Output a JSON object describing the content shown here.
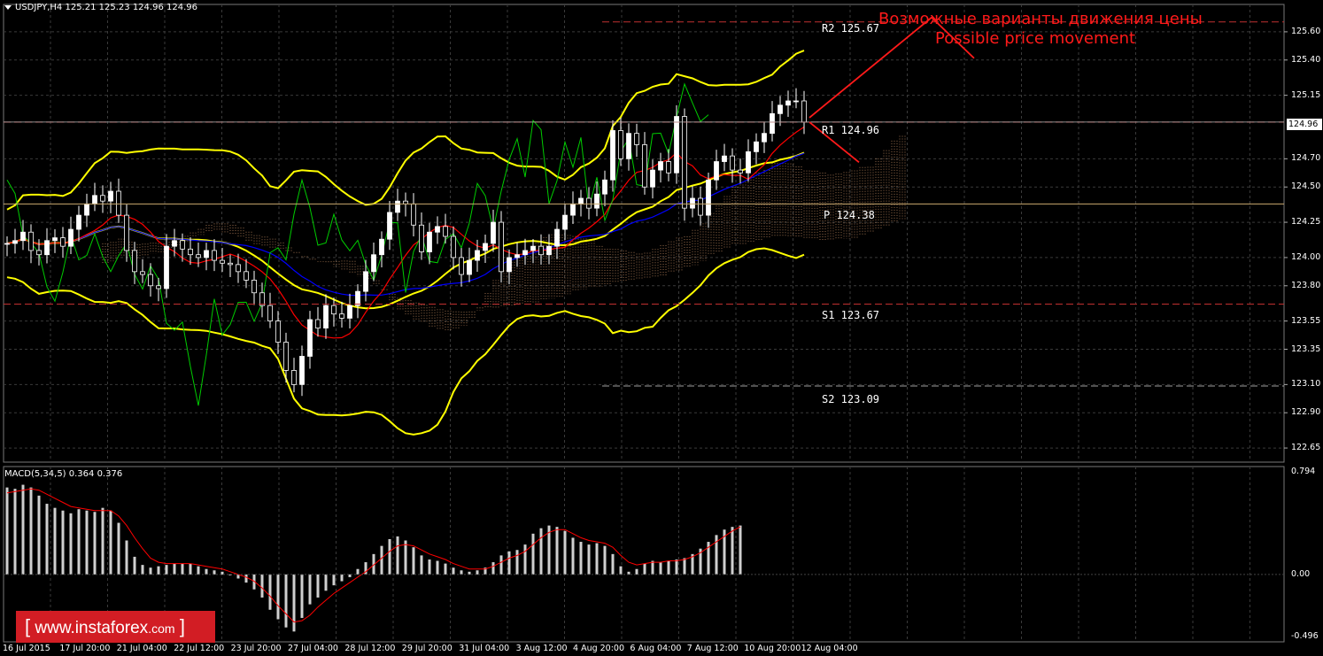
{
  "header": {
    "symbol_line": "USDJPY,H4  125.21 125.23 124.96 124.96"
  },
  "macd_header": "MACD(5,34,5) 0.364 0.376",
  "annotation": {
    "ru": "Возможные варианты движения цены",
    "en": "Possible price movement"
  },
  "levels": [
    {
      "label": "R2 125.67",
      "value": 125.67,
      "color": "#c03030"
    },
    {
      "label": "R1 124.96",
      "value": 124.96,
      "color": "#c03030"
    },
    {
      "label": "P 124.38",
      "value": 124.38,
      "color": "#c9a96e"
    },
    {
      "label": "S1 123.67",
      "value": 123.67,
      "color": "#c03030"
    },
    {
      "label": "S2 123.09",
      "value": 123.09,
      "color": "#a0a0a0"
    }
  ],
  "current_price": "124.96",
  "logo": {
    "bracket_left": "[",
    "text": "www.instaforex",
    "suffix": ".com",
    "bracket_right": "]"
  },
  "colors": {
    "background": "#000000",
    "grid": "#3a3a3a",
    "bull_candle": "#ffffff",
    "bear_candle": "#ffffff",
    "bollinger": "#ffff00",
    "chikou": "#00cc00",
    "tenkan": "#ff0000",
    "kijun": "#0000ff",
    "cloud": "#e0a070",
    "macd_hist": "#cfcfcf",
    "macd_signal": "#ff0000",
    "annotation": "#ff1a1a"
  },
  "chart_data": {
    "type": "candlestick",
    "symbol": "USDJPY",
    "timeframe": "H4",
    "ylim": [
      122.55,
      125.75
    ],
    "y_ticks": [
      "125.60",
      "125.40",
      "125.15",
      "124.96",
      "124.70",
      "124.50",
      "124.25",
      "124.00",
      "123.80",
      "123.55",
      "123.35",
      "123.10",
      "122.90",
      "122.65"
    ],
    "x_ticks": [
      "16 Jul 2015",
      "17 Jul 20:00",
      "21 Jul 04:00",
      "22 Jul 12:00",
      "23 Jul 20:00",
      "27 Jul 04:00",
      "28 Jul 12:00",
      "29 Jul 20:00",
      "31 Jul 04:00",
      "3 Aug 12:00",
      "4 Aug 20:00",
      "6 Aug 04:00",
      "7 Aug 12:00",
      "10 Aug 20:00",
      "12 Aug 04:00"
    ],
    "close": [
      124.1,
      124.12,
      124.18,
      124.05,
      124.02,
      124.12,
      124.14,
      124.08,
      124.2,
      124.3,
      124.38,
      124.44,
      124.4,
      124.47,
      124.3,
      124.05,
      123.9,
      123.88,
      123.8,
      123.78,
      124.08,
      124.12,
      124.06,
      124.02,
      124.0,
      124.05,
      123.98,
      123.96,
      123.95,
      123.9,
      123.84,
      123.75,
      123.66,
      123.55,
      123.4,
      123.2,
      123.1,
      123.3,
      123.56,
      123.5,
      123.66,
      123.6,
      123.57,
      123.66,
      123.76,
      123.9,
      124.02,
      124.13,
      124.32,
      124.4,
      124.38,
      124.23,
      124.04,
      124.18,
      124.22,
      124.15,
      124.0,
      123.88,
      123.98,
      124.05,
      124.1,
      124.25,
      123.9,
      124.0,
      124.02,
      124.05,
      124.08,
      124.02,
      124.08,
      124.2,
      124.3,
      124.38,
      124.42,
      124.35,
      124.45,
      124.55,
      124.9,
      124.7,
      124.88,
      124.8,
      124.5,
      124.62,
      124.68,
      124.6,
      125.0,
      124.35,
      124.42,
      124.3,
      124.55,
      124.68,
      124.72,
      124.62,
      124.6,
      124.75,
      124.82,
      124.88,
      125.02,
      125.08,
      125.11,
      125.11,
      124.96
    ],
    "macd_hist": [
      0.64,
      0.63,
      0.66,
      0.64,
      0.58,
      0.52,
      0.49,
      0.47,
      0.45,
      0.48,
      0.47,
      0.46,
      0.49,
      0.47,
      0.38,
      0.25,
      0.13,
      0.07,
      0.05,
      0.06,
      0.07,
      0.08,
      0.08,
      0.08,
      0.06,
      0.04,
      0.03,
      0.02,
      0.0,
      -0.03,
      -0.06,
      -0.11,
      -0.17,
      -0.26,
      -0.33,
      -0.39,
      -0.42,
      -0.32,
      -0.22,
      -0.17,
      -0.12,
      -0.08,
      -0.05,
      -0.02,
      0.04,
      0.09,
      0.15,
      0.21,
      0.26,
      0.28,
      0.25,
      0.2,
      0.14,
      0.11,
      0.1,
      0.08,
      0.05,
      0.03,
      0.02,
      0.03,
      0.05,
      0.09,
      0.14,
      0.17,
      0.18,
      0.22,
      0.3,
      0.34,
      0.36,
      0.35,
      0.32,
      0.27,
      0.24,
      0.22,
      0.23,
      0.21,
      0.15,
      0.06,
      0.02,
      0.04,
      0.08,
      0.1,
      0.09,
      0.1,
      0.11,
      0.12,
      0.15,
      0.19,
      0.24,
      0.29,
      0.33,
      0.35,
      0.36
    ],
    "macd_signal": [
      0.6,
      0.61,
      0.62,
      0.63,
      0.62,
      0.59,
      0.56,
      0.53,
      0.5,
      0.49,
      0.48,
      0.47,
      0.47,
      0.47,
      0.43,
      0.36,
      0.27,
      0.19,
      0.12,
      0.09,
      0.08,
      0.08,
      0.08,
      0.08,
      0.07,
      0.06,
      0.05,
      0.04,
      0.02,
      0.0,
      -0.02,
      -0.05,
      -0.1,
      -0.16,
      -0.23,
      -0.29,
      -0.35,
      -0.34,
      -0.3,
      -0.24,
      -0.19,
      -0.14,
      -0.1,
      -0.06,
      -0.02,
      0.02,
      0.07,
      0.12,
      0.17,
      0.21,
      0.22,
      0.21,
      0.18,
      0.15,
      0.13,
      0.11,
      0.08,
      0.06,
      0.04,
      0.04,
      0.04,
      0.06,
      0.09,
      0.12,
      0.14,
      0.17,
      0.22,
      0.27,
      0.31,
      0.33,
      0.33,
      0.3,
      0.27,
      0.25,
      0.24,
      0.23,
      0.2,
      0.14,
      0.09,
      0.07,
      0.08,
      0.09,
      0.09,
      0.1,
      0.1,
      0.11,
      0.13,
      0.16,
      0.2,
      0.24,
      0.28,
      0.32,
      0.35
    ],
    "macd_ylim": [
      -0.496,
      0.794
    ],
    "macd_ticks": [
      "0.794",
      "0.00",
      "-0.496"
    ]
  }
}
